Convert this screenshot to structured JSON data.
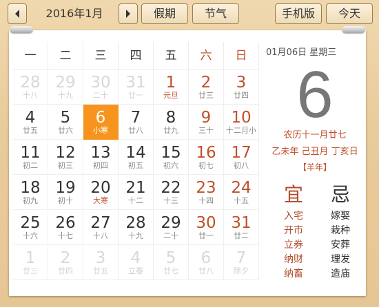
{
  "toolbar": {
    "month_label": "2016年1月",
    "jieqi_label": "节气",
    "holiday_label": "假期",
    "mobile_label": "手机版",
    "today_label": "今天"
  },
  "weekdays": [
    "一",
    "二",
    "三",
    "四",
    "五",
    "六",
    "日"
  ],
  "days": [
    {
      "num": "28",
      "sub": "十八",
      "type": "other"
    },
    {
      "num": "29",
      "sub": "十九",
      "type": "other"
    },
    {
      "num": "30",
      "sub": "二十",
      "type": "other"
    },
    {
      "num": "31",
      "sub": "廿一",
      "type": "other"
    },
    {
      "num": "1",
      "sub": "元旦",
      "type": "holiday"
    },
    {
      "num": "2",
      "sub": "廿三",
      "type": "weekend"
    },
    {
      "num": "3",
      "sub": "廿四",
      "type": "weekend"
    },
    {
      "num": "4",
      "sub": "廿五",
      "type": "normal"
    },
    {
      "num": "5",
      "sub": "廿六",
      "type": "normal"
    },
    {
      "num": "6",
      "sub": "小寒",
      "type": "today"
    },
    {
      "num": "7",
      "sub": "廿八",
      "type": "normal"
    },
    {
      "num": "8",
      "sub": "廿九",
      "type": "normal"
    },
    {
      "num": "9",
      "sub": "三十",
      "type": "weekend"
    },
    {
      "num": "10",
      "sub": "十二月小",
      "type": "weekend"
    },
    {
      "num": "11",
      "sub": "初二",
      "type": "normal"
    },
    {
      "num": "12",
      "sub": "初三",
      "type": "normal"
    },
    {
      "num": "13",
      "sub": "初四",
      "type": "normal"
    },
    {
      "num": "14",
      "sub": "初五",
      "type": "normal"
    },
    {
      "num": "15",
      "sub": "初六",
      "type": "normal"
    },
    {
      "num": "16",
      "sub": "初七",
      "type": "weekend"
    },
    {
      "num": "17",
      "sub": "初八",
      "type": "weekend"
    },
    {
      "num": "18",
      "sub": "初九",
      "type": "normal"
    },
    {
      "num": "19",
      "sub": "初十",
      "type": "normal"
    },
    {
      "num": "20",
      "sub": "大寒",
      "type": "term"
    },
    {
      "num": "21",
      "sub": "十二",
      "type": "normal"
    },
    {
      "num": "22",
      "sub": "十三",
      "type": "normal"
    },
    {
      "num": "23",
      "sub": "十四",
      "type": "weekend"
    },
    {
      "num": "24",
      "sub": "十五",
      "type": "weekend"
    },
    {
      "num": "25",
      "sub": "十六",
      "type": "normal"
    },
    {
      "num": "26",
      "sub": "十七",
      "type": "normal"
    },
    {
      "num": "27",
      "sub": "十八",
      "type": "normal"
    },
    {
      "num": "28",
      "sub": "十九",
      "type": "normal"
    },
    {
      "num": "29",
      "sub": "二十",
      "type": "normal"
    },
    {
      "num": "30",
      "sub": "廿一",
      "type": "weekend"
    },
    {
      "num": "31",
      "sub": "廿二",
      "type": "weekend"
    },
    {
      "num": "1",
      "sub": "廿三",
      "type": "other"
    },
    {
      "num": "2",
      "sub": "廿四",
      "type": "other"
    },
    {
      "num": "3",
      "sub": "廿五",
      "type": "other"
    },
    {
      "num": "4",
      "sub": "立春",
      "type": "other"
    },
    {
      "num": "5",
      "sub": "廿七",
      "type": "other"
    },
    {
      "num": "6",
      "sub": "廿八",
      "type": "other"
    },
    {
      "num": "7",
      "sub": "除夕",
      "type": "other"
    }
  ],
  "info": {
    "date_line": "01月06日 星期三",
    "big_day": "6",
    "lunar": "农历十一月廿七",
    "ganzhi": "乙未年 己丑月 丁亥日",
    "zodiac": "【羊年】",
    "yi_label": "宜",
    "ji_label": "忌",
    "yi": [
      "入宅",
      "开市",
      "立券",
      "纳财",
      "纳畜"
    ],
    "ji": [
      "嫁娶",
      "栽种",
      "安葬",
      "理发",
      "造庙"
    ]
  },
  "colors": {
    "accent": "#f7941d",
    "holiday_red": "#c0502b",
    "wood": "#e9cc9c"
  }
}
